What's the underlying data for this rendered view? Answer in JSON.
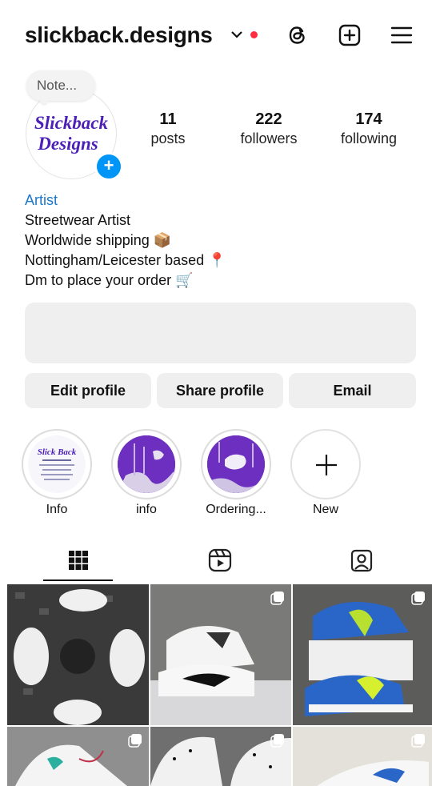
{
  "header": {
    "username": "slickback.designs",
    "icons": [
      "chevron-down-icon",
      "threads-icon",
      "new-post-icon",
      "menu-icon"
    ],
    "notification_dot_color": "#ff2d3f"
  },
  "note": {
    "placeholder": "Note..."
  },
  "avatar": {
    "logo_line1": "Slickback",
    "logo_line2": "Designs"
  },
  "stats": [
    {
      "value": "11",
      "label": "posts"
    },
    {
      "value": "222",
      "label": "followers"
    },
    {
      "value": "174",
      "label": "following"
    }
  ],
  "bio": {
    "category": "Artist",
    "lines": [
      "Streetwear Artist",
      "Worldwide shipping 📦",
      "Nottingham/Leicester based 📍",
      "Dm to place your order 🛒"
    ]
  },
  "buttons": {
    "edit": "Edit profile",
    "share": "Share profile",
    "email": "Email"
  },
  "highlights": [
    {
      "label": "Info"
    },
    {
      "label": "info"
    },
    {
      "label": "Ordering..."
    },
    {
      "label": "New"
    }
  ],
  "tabs": [
    "grid-icon",
    "reels-icon",
    "tagged-icon"
  ],
  "colors": {
    "accent": "#0095f6",
    "category": "#1a77c9",
    "logo_purple": "#4b1fb8"
  }
}
